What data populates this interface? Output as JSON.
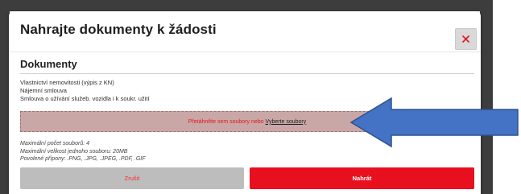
{
  "dialog": {
    "title": "Nahrajte dokumenty k žádosti",
    "close_icon": "close-icon"
  },
  "documents": {
    "section_title": "Dokumenty",
    "items": [
      "Vlastnictví nemovitosti (výpis z KN)",
      "Nájemní smlouva",
      "Smlouva o užívání služeb. vozidla i k soukr. užití"
    ]
  },
  "dropzone": {
    "text": "Přetáhněte sem soubory nebo",
    "link": "Vyberte soubory"
  },
  "limits": [
    "Maximální počet souborů: 4",
    "Maximální velikost jednoho souboru: 20MB",
    "Povolené přípony: .PNG, .JPG, .JPEG, .PDF, .GIF"
  ],
  "buttons": {
    "cancel": "Zrušit",
    "upload": "Nahrát"
  },
  "colors": {
    "accent_red": "#e8101f",
    "dropzone_bg": "#c9a7a7",
    "arrow_blue": "#4472c4"
  },
  "annotation": {
    "icon": "left-arrow-icon"
  }
}
